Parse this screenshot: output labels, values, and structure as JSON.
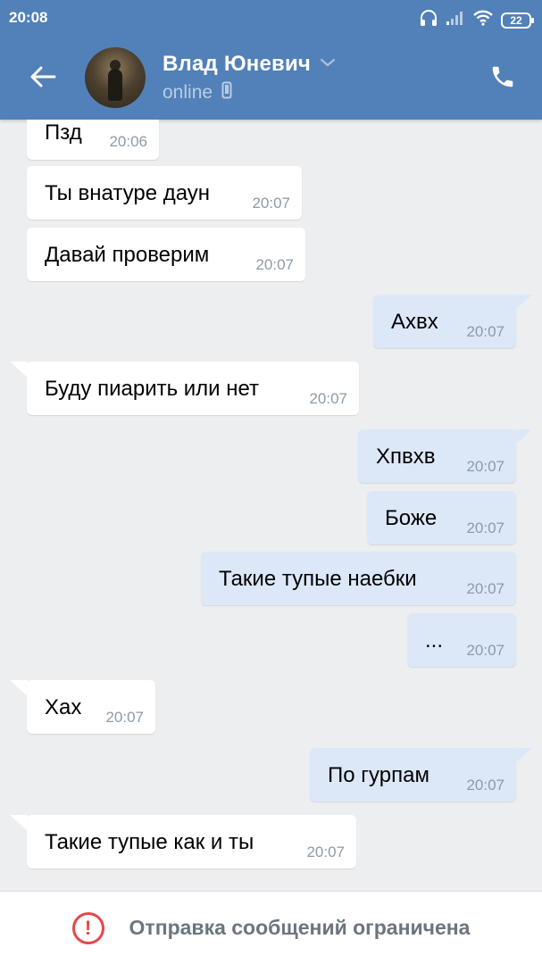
{
  "status_bar": {
    "time": "20:08",
    "battery": "22",
    "icons": [
      "headphones-icon",
      "signal-icon",
      "wifi-icon",
      "battery-icon"
    ]
  },
  "header": {
    "name": "Влад Юневич",
    "status": "online",
    "icons": [
      "back-arrow-icon",
      "chevron-down-icon",
      "mobile-phone-icon",
      "phone-call-icon"
    ]
  },
  "messages": [
    {
      "dir": "in",
      "text": "Пзд",
      "time": "20:06"
    },
    {
      "dir": "in",
      "text": "Ты внатуре даун",
      "time": "20:07"
    },
    {
      "dir": "in",
      "text": "Давай проверим",
      "time": "20:07"
    },
    {
      "dir": "out",
      "text": "Ахвх",
      "time": "20:07"
    },
    {
      "dir": "in",
      "text": "Буду пиарить или нет",
      "time": "20:07"
    },
    {
      "dir": "out",
      "text": "Хпвхв",
      "time": "20:07"
    },
    {
      "dir": "out",
      "text": "Боже",
      "time": "20:07"
    },
    {
      "dir": "out",
      "text": "Такие тупые наебки",
      "time": "20:07"
    },
    {
      "dir": "out",
      "text": "...",
      "time": "20:07"
    },
    {
      "dir": "in",
      "text": "Хах",
      "time": "20:07"
    },
    {
      "dir": "out",
      "text": "По гурпам",
      "time": "20:07"
    },
    {
      "dir": "in",
      "text": "Такие тупые как и ты",
      "time": "20:07"
    }
  ],
  "footer": {
    "text": "Отправка сообщений ограничена",
    "icon": "warning-icon"
  },
  "colors": {
    "header_blue": "#5181b8",
    "incoming_bubble": "#ffffff",
    "outgoing_bubble": "#dce8f8",
    "background": "#edeef0",
    "warning_red": "#e64646"
  }
}
